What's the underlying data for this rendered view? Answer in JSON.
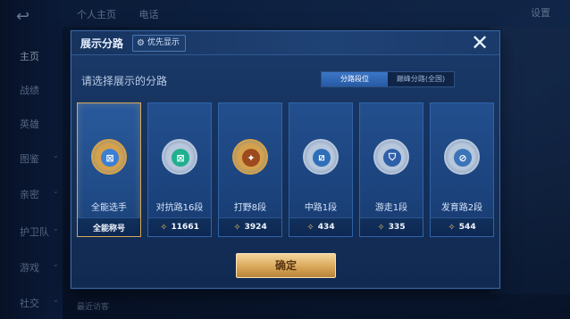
{
  "background": {
    "nav": [
      "主页",
      "战绩",
      "英雄",
      "图鉴",
      "亲密",
      "护卫队",
      "游戏",
      "社交"
    ],
    "tabs": [
      "个人主页",
      "电话"
    ],
    "settings": "设置",
    "bottom_text": "最近访客"
  },
  "dialog": {
    "title": "展示分路",
    "priority_label": "优先显示",
    "prompt": "请选择展示的分路",
    "toggle": {
      "option_a": "分路段位",
      "option_b": "巅峰分路(全国)",
      "selected": "分路段位"
    },
    "cards": [
      {
        "label": "全能选手",
        "footer": "全能称号",
        "selected": true,
        "ring": "#d4a24c",
        "fill": "#3b7fd6",
        "glyph": "⊠"
      },
      {
        "label": "对抗路16段",
        "footer": "11661",
        "selected": false,
        "ring": "#b7c7dc",
        "fill": "#1fb08e",
        "glyph": "⊠"
      },
      {
        "label": "打野8段",
        "footer": "3924",
        "selected": false,
        "ring": "#d4a24c",
        "fill": "#9c4a1e",
        "glyph": "✦"
      },
      {
        "label": "中路1段",
        "footer": "434",
        "selected": false,
        "ring": "#b7c7dc",
        "fill": "#2e6fb8",
        "glyph": "⧄"
      },
      {
        "label": "游走1段",
        "footer": "335",
        "selected": false,
        "ring": "#b7c7dc",
        "fill": "#2f5fa8",
        "glyph": "⛉"
      },
      {
        "label": "发育路2段",
        "footer": "544",
        "selected": false,
        "ring": "#b7c7dc",
        "fill": "#3b74b8",
        "glyph": "⊘"
      }
    ],
    "confirm_label": "确定"
  }
}
